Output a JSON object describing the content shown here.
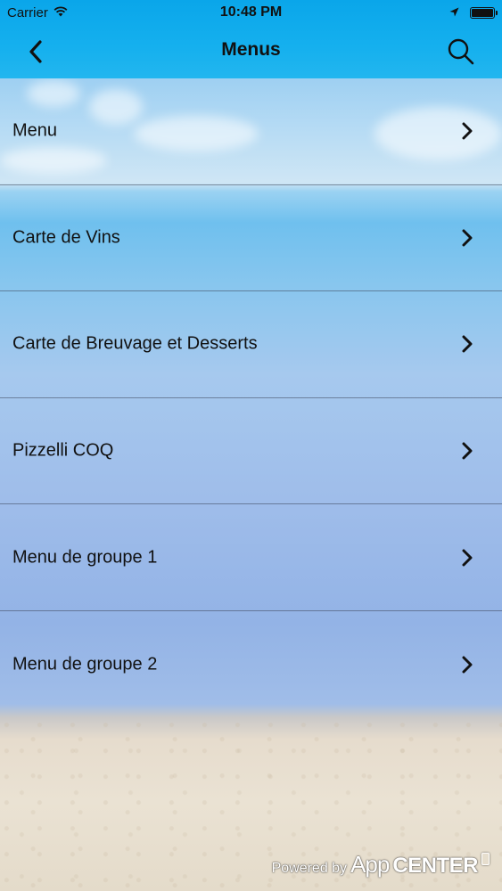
{
  "status_bar": {
    "carrier": "Carrier",
    "time": "10:48 PM",
    "battery_level": 1.0
  },
  "nav": {
    "title": "Menus",
    "back_icon": "chevron-left-icon",
    "search_icon": "search-icon"
  },
  "menu_items": [
    {
      "label": "Menu"
    },
    {
      "label": "Carte de Vins"
    },
    {
      "label": "Carte de Breuvage et Desserts"
    },
    {
      "label": "Pizzelli COQ"
    },
    {
      "label": "Menu de groupe 1"
    },
    {
      "label": "Menu de groupe 2"
    }
  ],
  "footer": {
    "powered_by": "Powered by",
    "brand_app": "App",
    "brand_center": "CENTER"
  },
  "colors": {
    "nav_bar": "#15b0ee",
    "text": "#111111"
  }
}
